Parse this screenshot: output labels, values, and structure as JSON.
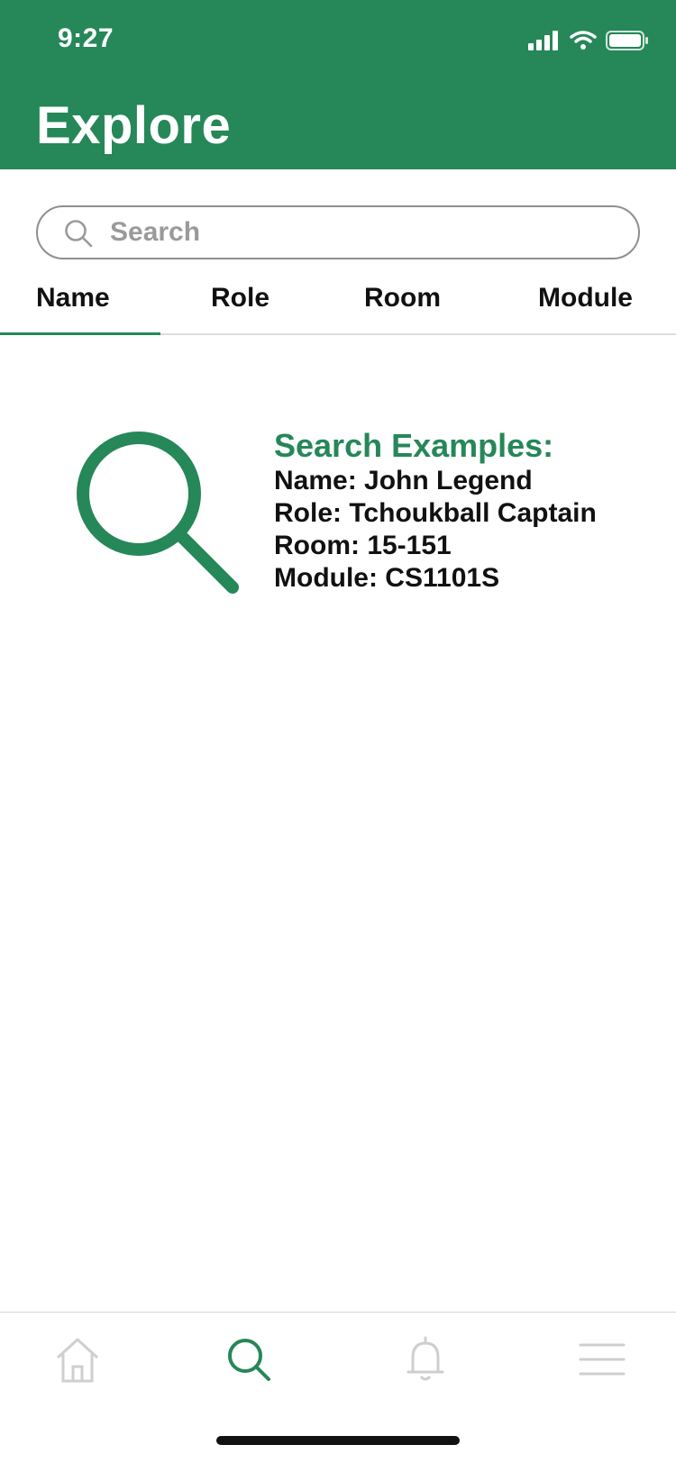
{
  "status_bar": {
    "time": "9:27"
  },
  "header": {
    "title": "Explore"
  },
  "search": {
    "placeholder": "Search",
    "value": ""
  },
  "tabs": [
    {
      "label": "Name",
      "selected": true
    },
    {
      "label": "Role",
      "selected": false
    },
    {
      "label": "Room",
      "selected": false
    },
    {
      "label": "Module",
      "selected": false
    }
  ],
  "examples": {
    "title": "Search Examples:",
    "lines": [
      "Name: John Legend",
      "Role: Tchoukball Captain",
      "Room: 15-151",
      "Module: CS1101S"
    ]
  },
  "tabbar": {
    "items": [
      {
        "icon": "home-icon",
        "active": false
      },
      {
        "icon": "search-icon",
        "active": true
      },
      {
        "icon": "bell-icon",
        "active": false
      },
      {
        "icon": "menu-icon",
        "active": false
      }
    ]
  },
  "colors": {
    "brand": "#268758",
    "inactive_icon": "#cfcfcf",
    "placeholder": "#9a9a9a"
  }
}
